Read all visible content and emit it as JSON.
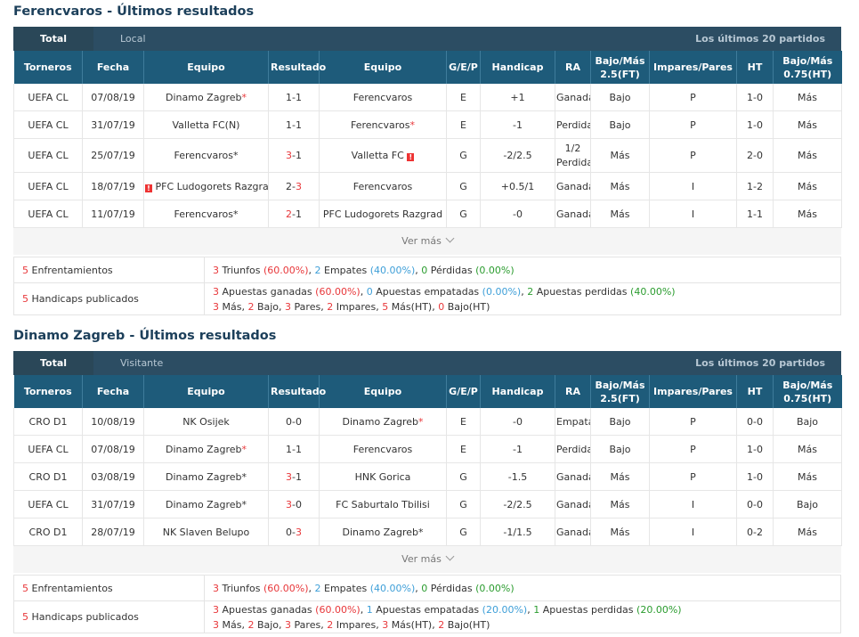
{
  "colors": {
    "header_bg": "#1e5b7a",
    "tabbar_bg": "#2c4d63",
    "red": "#e8373a",
    "blue": "#1f47c4",
    "light_blue": "#3e9fd8",
    "green": "#2b9c2f"
  },
  "headers": [
    "Torneros",
    "Fecha",
    "Equipo",
    "Resultado",
    "Equipo",
    "G/E/P",
    "Handicap",
    "RA",
    "Bajo/Más 2.5(FT)",
    "Impares/Pares",
    "HT",
    "Bajo/Más 0.75(HT)"
  ],
  "header_parts": {
    "bm25_a": "Bajo/Más",
    "bm25_b": "2.5(FT)",
    "bm075_a": "Bajo/Más",
    "bm075_b": "0.75(HT)"
  },
  "section1": {
    "title": "Ferencvaros - Últimos resultados",
    "tab_total": "Total",
    "tab_other": "Local",
    "tab_right": "Los últimos 20 partidos",
    "vermas": "Ver más",
    "rows": [
      {
        "comp": "UEFA CL",
        "date": "07/08/19",
        "home": "Dinamo Zagreb",
        "home_star": "*",
        "score_h": "1",
        "score_sep": "-",
        "score_a": "1",
        "away": "Ferencvaros",
        "away_star": "",
        "gep": "E",
        "hcp": "+1",
        "ra": "Ganada",
        "bm": "Bajo",
        "ip": "P",
        "ht": "1-0",
        "bm2": "Más"
      },
      {
        "comp": "UEFA CL",
        "date": "31/07/19",
        "home": "Valletta FC(N)",
        "home_star": "",
        "score_h": "1",
        "score_sep": "-",
        "score_a": "1",
        "away": "Ferencvaros",
        "away_star": "*",
        "gep": "E",
        "hcp": "-1",
        "ra": "Perdida",
        "bm": "Bajo",
        "ip": "P",
        "ht": "1-0",
        "bm2": "Más"
      },
      {
        "comp": "UEFA CL",
        "date": "25/07/19",
        "home": "Ferencvaros",
        "home_star": "*",
        "score_h": "3",
        "score_sep": "-",
        "score_a": "1",
        "away": "Valletta FC",
        "away_star": "",
        "gep": "G",
        "hcp": "-2/2.5",
        "ra_a": "1/2",
        "ra_b": "Perdida",
        "bm": "Más",
        "ip": "P",
        "ht": "2-0",
        "bm2": "Más"
      },
      {
        "comp": "UEFA CL",
        "date": "18/07/19",
        "home": "PFC Ludogorets Razgrad",
        "home_star": "*",
        "score_h": "2",
        "score_sep": "-",
        "score_a": "3",
        "away": "Ferencvaros",
        "away_star": "",
        "gep": "G",
        "hcp": "+0.5/1",
        "ra": "Ganada",
        "bm": "Más",
        "ip": "I",
        "ht": "1-2",
        "bm2": "Más"
      },
      {
        "comp": "UEFA CL",
        "date": "11/07/19",
        "home": "Ferencvaros",
        "home_star": "*",
        "score_h": "2",
        "score_sep": "-",
        "score_a": "1",
        "away": "PFC Ludogorets Razgrad",
        "away_star": "",
        "gep": "G",
        "hcp": "-0",
        "ra": "Ganada",
        "bm": "Más",
        "ip": "I",
        "ht": "1-1",
        "bm2": "Más"
      }
    ],
    "sum1_label_n": "5",
    "sum1_label": "Enfrentamientos",
    "sum1": {
      "w": "3",
      "wl": "Triunfos",
      "wp": "(60.00%)",
      "d": "2",
      "dl": "Empates",
      "dp": "(40.00%)",
      "l": "0",
      "ll": "Pérdidas",
      "lp": "(0.00%)"
    },
    "sum2_label_n": "5",
    "sum2_label": "Handicaps publicados",
    "sum2": {
      "a": "3",
      "al": "Apuestas ganadas",
      "ap": "(60.00%)",
      "b": "0",
      "bl": "Apuestas empatadas",
      "bp": "(0.00%)",
      "c": "2",
      "cl": "Apuestas perdidas",
      "cp": "(40.00%)",
      "m": "3",
      "ml": "Más",
      "bj": "2",
      "bjl": "Bajo",
      "pa": "3",
      "pal": "Pares",
      "im": "2",
      "iml": "Impares",
      "mht": "5",
      "mhtl": "Más(HT)",
      "bht": "0",
      "bhtl": "Bajo(HT)"
    }
  },
  "section2": {
    "title": "Dinamo Zagreb - Últimos resultados",
    "tab_total": "Total",
    "tab_other": "Visitante",
    "tab_right": "Los últimos 20 partidos",
    "vermas": "Ver más",
    "rows": [
      {
        "comp": "CRO D1",
        "date": "10/08/19",
        "home": "NK Osijek",
        "home_star": "",
        "score_h": "0",
        "score_sep": "-",
        "score_a": "0",
        "away": "Dinamo Zagreb",
        "away_star": "*",
        "gep": "E",
        "hcp": "-0",
        "ra": "Empatada",
        "bm": "Bajo",
        "ip": "P",
        "ht": "0-0",
        "bm2": "Bajo"
      },
      {
        "comp": "UEFA CL",
        "date": "07/08/19",
        "home": "Dinamo Zagreb",
        "home_star": "*",
        "score_h": "1",
        "score_sep": "-",
        "score_a": "1",
        "away": "Ferencvaros",
        "away_star": "",
        "gep": "E",
        "hcp": "-1",
        "ra": "Perdida",
        "bm": "Bajo",
        "ip": "P",
        "ht": "1-0",
        "bm2": "Más"
      },
      {
        "comp": "CRO D1",
        "date": "03/08/19",
        "home": "Dinamo Zagreb",
        "home_star": "*",
        "score_h": "3",
        "score_sep": "-",
        "score_a": "1",
        "away": "HNK Gorica",
        "away_star": "",
        "gep": "G",
        "hcp": "-1.5",
        "ra": "Ganada",
        "bm": "Más",
        "ip": "P",
        "ht": "1-0",
        "bm2": "Más"
      },
      {
        "comp": "UEFA CL",
        "date": "31/07/19",
        "home": "Dinamo Zagreb",
        "home_star": "*",
        "score_h": "3",
        "score_sep": "-",
        "score_a": "0",
        "away": "FC Saburtalo Tbilisi",
        "away_star": "",
        "gep": "G",
        "hcp": "-2/2.5",
        "ra": "Ganada",
        "bm": "Más",
        "ip": "I",
        "ht": "0-0",
        "bm2": "Bajo"
      },
      {
        "comp": "CRO D1",
        "date": "28/07/19",
        "home": "NK Slaven Belupo",
        "home_star": "",
        "score_h": "0",
        "score_sep": "-",
        "score_a": "3",
        "away": "Dinamo Zagreb",
        "away_star": "*",
        "gep": "G",
        "hcp": "-1/1.5",
        "ra": "Ganada",
        "bm": "Más",
        "ip": "I",
        "ht": "0-2",
        "bm2": "Más"
      }
    ],
    "sum1_label_n": "5",
    "sum1_label": "Enfrentamientos",
    "sum1": {
      "w": "3",
      "wl": "Triunfos",
      "wp": "(60.00%)",
      "d": "2",
      "dl": "Empates",
      "dp": "(40.00%)",
      "l": "0",
      "ll": "Pérdidas",
      "lp": "(0.00%)"
    },
    "sum2_label_n": "5",
    "sum2_label": "Handicaps publicados",
    "sum2": {
      "a": "3",
      "al": "Apuestas ganadas",
      "ap": "(60.00%)",
      "b": "1",
      "bl": "Apuestas empatadas",
      "bp": "(20.00%)",
      "c": "1",
      "cl": "Apuestas perdidas",
      "cp": "(20.00%)",
      "m": "3",
      "ml": "Más",
      "bj": "2",
      "bjl": "Bajo",
      "pa": "3",
      "pal": "Pares",
      "im": "2",
      "iml": "Impares",
      "mht": "3",
      "mhtl": "Más(HT)",
      "bht": "2",
      "bhtl": "Bajo(HT)"
    }
  }
}
